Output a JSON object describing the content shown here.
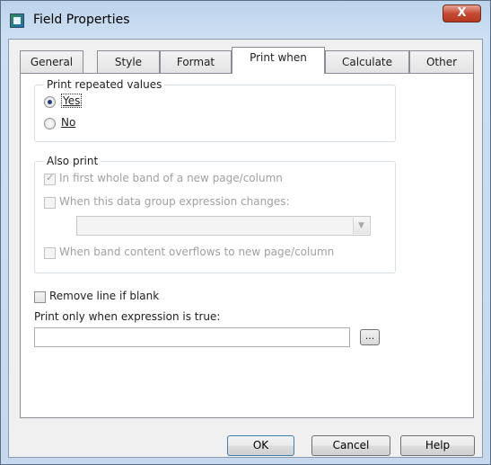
{
  "window": {
    "title": "Field Properties",
    "close_glyph": "X"
  },
  "tabs": [
    {
      "label": "General"
    },
    {
      "label": "Style"
    },
    {
      "label": "Format"
    },
    {
      "label": "Print when"
    },
    {
      "label": "Calculate"
    },
    {
      "label": "Other"
    }
  ],
  "active_tab": "Print when",
  "print_repeated": {
    "group_label": "Print repeated values",
    "yes_label": "Yes",
    "no_label": "No",
    "selected": "Yes"
  },
  "also_print": {
    "group_label": "Also print",
    "first_band_label": "In first whole band of a new page/column",
    "first_band_checked": true,
    "group_changes_label": "When this data group expression changes:",
    "group_changes_checked": false,
    "group_combo_value": "",
    "overflow_label": "When band content overflows to new page/column",
    "overflow_checked": false
  },
  "remove_line": {
    "label": "Remove line if blank",
    "checked": false
  },
  "expression": {
    "label": "Print only when expression is true:",
    "value": "",
    "browse_label": "..."
  },
  "buttons": {
    "ok": "OK",
    "cancel": "Cancel",
    "help": "Help"
  }
}
